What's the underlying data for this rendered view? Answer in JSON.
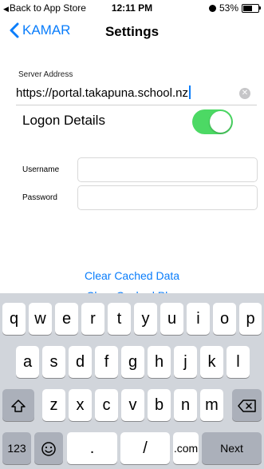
{
  "status_bar": {
    "back_label": "Back to App Store",
    "time": "12:11 PM",
    "battery": "53%",
    "battery_level": 0.53
  },
  "nav": {
    "back_label": "KAMAR",
    "title": "Settings"
  },
  "server": {
    "label": "Server Address",
    "value": "https://portal.takapuna.school.nz"
  },
  "logon": {
    "title": "Logon Details",
    "toggle_on": true,
    "username_label": "Username",
    "password_label": "Password",
    "username_value": "",
    "password_value": ""
  },
  "actions": {
    "clear_cached": "Clear Cached Data",
    "partial_link": "Clear Cached Pho"
  },
  "keyboard": {
    "row1": [
      "q",
      "w",
      "e",
      "r",
      "t",
      "y",
      "u",
      "i",
      "o",
      "p"
    ],
    "row2": [
      "a",
      "s",
      "d",
      "f",
      "g",
      "h",
      "j",
      "k",
      "l"
    ],
    "row3": [
      "z",
      "x",
      "c",
      "v",
      "b",
      "n",
      "m"
    ],
    "numbers": "123",
    "dot": ".",
    "slash": "/",
    "dotcom": ".com",
    "next": "Next"
  },
  "colors": {
    "accent": "#0a7dfb",
    "toggle": "#4cd964",
    "keyboard_bg": "#d1d5db"
  }
}
